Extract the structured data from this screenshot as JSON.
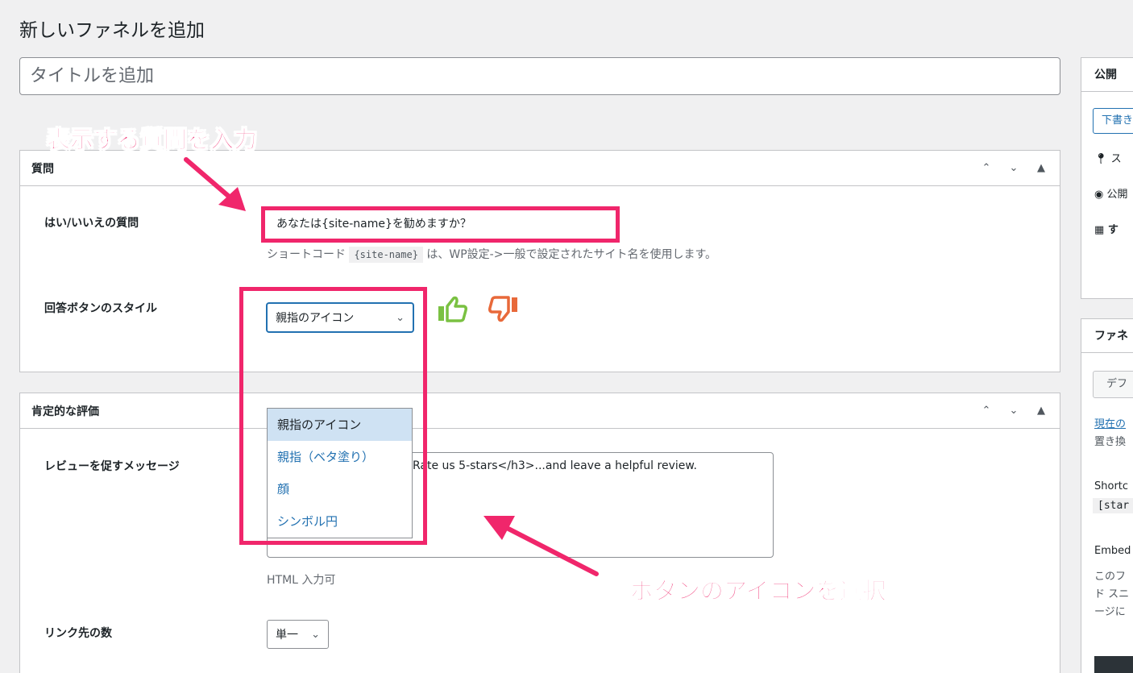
{
  "page": {
    "title": "新しいファネルを追加",
    "title_placeholder": "タイトルを追加"
  },
  "question_box": {
    "title": "質問",
    "yes_no_label": "はい/いいえの質問",
    "yes_no_value": "あなたは{site-name}を勧めますか？",
    "help_prefix": "ショートコード",
    "help_code": "{site-name}",
    "help_suffix": "は、WP設定->一般で設定されたサイト名を使用します。",
    "button_style_label": "回答ボタンのスタイル",
    "button_style_selected": "親指のアイコン",
    "thumb_up_color": "#7ac142",
    "thumb_down_color": "#e8693a"
  },
  "positive_box": {
    "title": "肯定的な評価",
    "review_message_label": "レビューを促すメッセージ",
    "review_message_value": "Rate us 5-stars</h3>...and leave a helpful review.",
    "html_note": "HTML 入力可",
    "link_count_label": "リンク先の数",
    "link_count_selected": "単一"
  },
  "dropdown": {
    "options": [
      "親指のアイコン",
      "親指（ベタ塗り）",
      "顔",
      "シンボル円"
    ]
  },
  "sidebar": {
    "publish_title": "公開",
    "draft_button": "下書き",
    "status_row": "ス",
    "visibility_row": "公開",
    "schedule_row": "す",
    "funnel_title": "ファネ",
    "default_button": "デフ",
    "current_link": "現在の",
    "replace_text": "置き換",
    "shortcode_label": "Shortc",
    "shortcode_value": "[star",
    "embed_label": "Embed",
    "embed_l1": "このフ",
    "embed_l2": "ド スニ",
    "embed_l3": "ージに"
  },
  "annotations": {
    "question_note": "表示する質問を入力",
    "icon_note": "ボタンのアイコンを選択",
    "color": "#f0266b"
  }
}
